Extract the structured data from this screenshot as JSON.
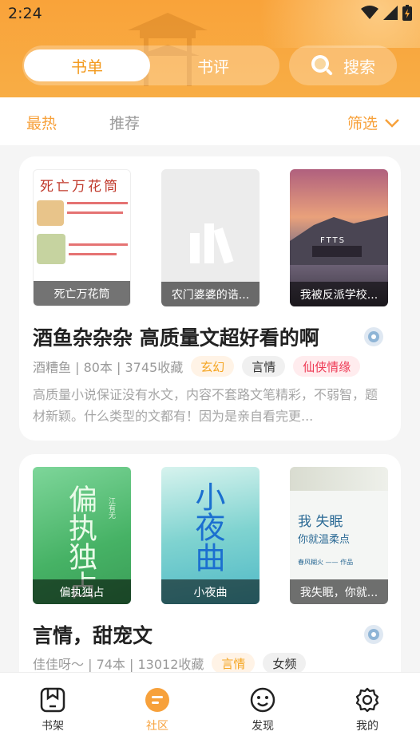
{
  "status": {
    "time": "2:24"
  },
  "header": {
    "tabs": [
      {
        "label": "书单"
      },
      {
        "label": "书评"
      }
    ],
    "search_label": "搜索"
  },
  "filter": {
    "hot": "最热",
    "recommend": "推荐",
    "filter_label": "筛选"
  },
  "lists": [
    {
      "title": "酒鱼杂杂杂 高质量文超好看的啊",
      "meta": "酒糟鱼 | 80本 | 3745收藏",
      "tags": [
        {
          "label": "玄幻"
        },
        {
          "label": "言情"
        },
        {
          "label": "仙侠情缘"
        }
      ],
      "desc": "高质量小说保证没有水文，内容不套路文笔精彩，不弱智，题材新颖。什么类型的文都有！因为是亲自看完更...",
      "books": [
        {
          "caption": "死亡万花筒",
          "cover_title": "死亡万花筒"
        },
        {
          "caption": "农门婆婆的诰..."
        },
        {
          "caption": "我被反派学校...",
          "cover_text": "FTTS"
        }
      ]
    },
    {
      "title": "言情，甜宠文",
      "meta": "佳佳呀～ | 74本 | 13012收藏",
      "tags": [
        {
          "label": "言情"
        },
        {
          "label": "女频"
        }
      ],
      "books": [
        {
          "caption": "偏执独占",
          "cover_title": "偏执独占",
          "cover_author": "江有无"
        },
        {
          "caption": "小夜曲",
          "cover_title": "小夜曲"
        },
        {
          "caption": "我失眠，你就...",
          "cover_title": "我 失眠",
          "cover_sub": "你就温柔点",
          "cover_author": "春风糊火 —— 作品"
        }
      ]
    }
  ],
  "bottom_nav": [
    {
      "label": "书架",
      "icon": "bookshelf-icon"
    },
    {
      "label": "社区",
      "icon": "community-icon"
    },
    {
      "label": "发现",
      "icon": "discover-icon"
    },
    {
      "label": "我的",
      "icon": "settings-icon"
    }
  ],
  "colors": {
    "accent": "#f7a13b",
    "tag_orange_bg": "#fff3e6",
    "tag_orange_text": "#f5a623",
    "tag_gray_bg": "#f0f0f0",
    "tag_pink_bg": "#ffecee",
    "tag_pink_text": "#ee3a55"
  }
}
